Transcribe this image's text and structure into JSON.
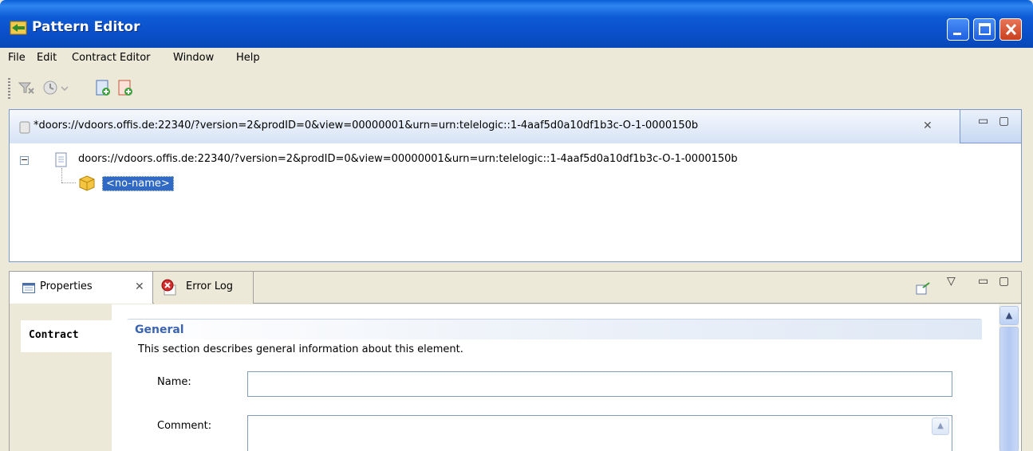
{
  "window": {
    "title": "Pattern Editor",
    "controls": {
      "minimize": "minimize",
      "maximize": "maximize",
      "close": "close"
    }
  },
  "menu": {
    "items": [
      {
        "label": "File"
      },
      {
        "label": "Edit"
      },
      {
        "label": "Contract Editor"
      },
      {
        "label": "Window"
      },
      {
        "label": "Help"
      }
    ]
  },
  "toolbar": {
    "icons": [
      "filter-icon",
      "history-icon",
      "new-document-icon",
      "add-document-icon"
    ]
  },
  "editor": {
    "tab_label": "*doors://vdoors.offis.de:22340/?version=2&prodID=0&view=00000001&urn=urn:telelogic::1-4aaf5d0a10df1b3c-O-1-0000150b",
    "tab_close": "✕",
    "minimize_glyph": "▭",
    "maximize_glyph": "▢",
    "tree": {
      "root_label": "doors://vdoors.offis.de:22340/?version=2&prodID=0&view=00000001&urn=urn:telelogic::1-4aaf5d0a10df1b3c-O-1-0000150b",
      "expander": "−",
      "child_label": "<no-name>"
    }
  },
  "properties": {
    "tabs": [
      {
        "label": "Properties",
        "close": "✕",
        "active": true
      },
      {
        "label": "Error Log",
        "active": false
      }
    ],
    "side_tabs": [
      {
        "label": "Contract"
      }
    ],
    "section": {
      "title": "General",
      "description": "This section describes general information about this element.",
      "fields": {
        "name_label": "Name:",
        "name_value": "",
        "comment_label": "Comment:",
        "comment_value": ""
      }
    },
    "view_menu_glyph": "▽",
    "minimize_glyph": "▭",
    "maximize_glyph": "▢"
  },
  "colors": {
    "titlebar": "#0a4fc9",
    "selection": "#316ac5",
    "section_title": "#3b64b0",
    "panel_border": "#7a99c8"
  }
}
